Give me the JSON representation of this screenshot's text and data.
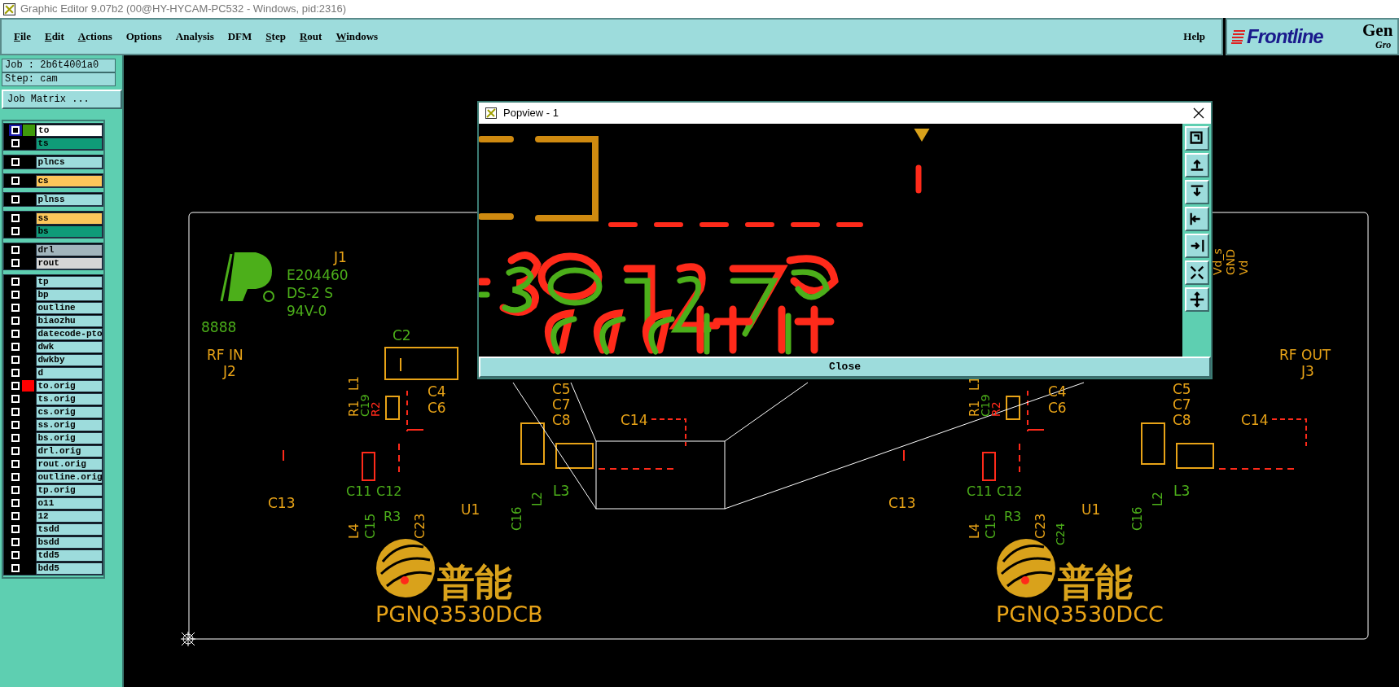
{
  "window": {
    "title": "Graphic Editor 9.07b2 (00@HY-HYCAM-PC532 - Windows, pid:2316)"
  },
  "menu": [
    {
      "label": "File",
      "mnemonic": true
    },
    {
      "label": "Edit",
      "mnemonic": true
    },
    {
      "label": "Actions",
      "mnemonic": true
    },
    {
      "label": "Options",
      "mnemonic": false
    },
    {
      "label": "Analysis",
      "mnemonic": false
    },
    {
      "label": "DFM",
      "mnemonic": false
    },
    {
      "label": "Step",
      "mnemonic": true
    },
    {
      "label": "Rout",
      "mnemonic": true
    },
    {
      "label": "Windows",
      "mnemonic": true
    }
  ],
  "help": "Help",
  "brand": {
    "name": "Frontline",
    "product": "Gen",
    "tagline": "Gro"
  },
  "job": {
    "job": "Job : 2b6t4001a0",
    "step": "Step: cam",
    "matrix_button": "Job Matrix ..."
  },
  "layer_groups": [
    [
      {
        "name": "to",
        "color": "#ffffff",
        "selected": true,
        "swatch": {
          "color": "#3f9a0c"
        }
      },
      {
        "name": "ts",
        "color": "#0f9b78",
        "selected": false
      }
    ],
    [
      {
        "name": "plncs",
        "color": "#9ddcdc",
        "selected": false
      }
    ],
    [
      {
        "name": "cs",
        "color": "#fcc65a",
        "selected": false
      }
    ],
    [
      {
        "name": "plnss",
        "color": "#9ddcdc",
        "selected": false
      }
    ],
    [
      {
        "name": "ss",
        "color": "#fcc65a",
        "selected": false
      },
      {
        "name": "bs",
        "color": "#0f9b78",
        "selected": false
      }
    ],
    [
      {
        "name": "drl",
        "color": "#a2b5bc",
        "selected": false
      },
      {
        "name": "rout",
        "color": "#d6d6d6",
        "selected": false
      }
    ],
    [
      {
        "name": "tp",
        "color": "#9ddcdc",
        "selected": false
      },
      {
        "name": "bp",
        "color": "#9ddcdc",
        "selected": false
      },
      {
        "name": "outline",
        "color": "#9ddcdc",
        "selected": false
      },
      {
        "name": "biaozhu",
        "color": "#9ddcdc",
        "selected": false
      },
      {
        "name": "datecode-pto",
        "color": "#9ddcdc",
        "selected": false
      },
      {
        "name": "dwk",
        "color": "#9ddcdc",
        "selected": false
      },
      {
        "name": "dwkby",
        "color": "#9ddcdc",
        "selected": false
      },
      {
        "name": "d",
        "color": "#9ddcdc",
        "selected": false
      },
      {
        "name": "to.orig",
        "color": "#9ddcdc",
        "selected": false,
        "swatch": {
          "color": "#ff0000"
        }
      },
      {
        "name": "ts.orig",
        "color": "#9ddcdc",
        "selected": false
      },
      {
        "name": "cs.orig",
        "color": "#9ddcdc",
        "selected": false
      },
      {
        "name": "ss.orig",
        "color": "#9ddcdc",
        "selected": false
      },
      {
        "name": "bs.orig",
        "color": "#9ddcdc",
        "selected": false
      },
      {
        "name": "drl.orig",
        "color": "#9ddcdc",
        "selected": false
      },
      {
        "name": "rout.orig",
        "color": "#9ddcdc",
        "selected": false
      },
      {
        "name": "outline.orig",
        "color": "#9ddcdc",
        "selected": false
      },
      {
        "name": "tp.orig",
        "color": "#9ddcdc",
        "selected": false
      },
      {
        "name": "o11",
        "color": "#9ddcdc",
        "selected": false
      },
      {
        "name": "12",
        "color": "#9ddcdc",
        "selected": false
      },
      {
        "name": "tsdd",
        "color": "#9ddcdc",
        "selected": false
      },
      {
        "name": "bsdd",
        "color": "#9ddcdc",
        "selected": false
      },
      {
        "name": "tdd5",
        "color": "#9ddcdc",
        "selected": false
      },
      {
        "name": "bdd5",
        "color": "#9ddcdc",
        "selected": false
      }
    ]
  ],
  "boards": [
    {
      "labels": [
        {
          "text": "J1",
          "color": "#e8a317"
        },
        {
          "text": "E204460",
          "color": "#4caf1a"
        },
        {
          "text": "DS-2 S",
          "color": "#4caf1a"
        },
        {
          "text": "94V-0",
          "color": "#4caf1a"
        },
        {
          "text": "8888",
          "color": "#4caf1a"
        },
        {
          "text": "RF IN",
          "color": "#e8a317"
        },
        {
          "text": "J2",
          "color": "#e8a317"
        },
        {
          "text": "C2",
          "color": "#4caf1a"
        },
        {
          "text": "L1",
          "color": "#e8a317"
        },
        {
          "text": "R1",
          "color": "#e8a317"
        },
        {
          "text": "C19",
          "color": "#4caf1a"
        },
        {
          "text": "R2",
          "color": "#ff2a1a"
        },
        {
          "text": "C4",
          "color": "#e8a317"
        },
        {
          "text": "C6",
          "color": "#e8a317"
        },
        {
          "text": "C5",
          "color": "#e8a317"
        },
        {
          "text": "C7",
          "color": "#e8a317"
        },
        {
          "text": "C8",
          "color": "#e8a317"
        },
        {
          "text": "C14",
          "color": "#e8a317"
        },
        {
          "text": "C13",
          "color": "#e8a317"
        },
        {
          "text": "C11",
          "color": "#4caf1a"
        },
        {
          "text": "C12",
          "color": "#4caf1a"
        },
        {
          "text": "L4",
          "color": "#e8a317"
        },
        {
          "text": "C15",
          "color": "#4caf1a"
        },
        {
          "text": "R3",
          "color": "#4caf1a"
        },
        {
          "text": "C23",
          "color": "#e8a317"
        },
        {
          "text": "U1",
          "color": "#e8a317"
        },
        {
          "text": "C16",
          "color": "#4caf1a"
        },
        {
          "text": "L2",
          "color": "#4caf1a"
        },
        {
          "text": "L3",
          "color": "#4caf1a"
        },
        {
          "text": "普能",
          "color": "#d9a21b"
        },
        {
          "text": "PGNQ3530DCB",
          "color": "#e8a317"
        }
      ]
    },
    {
      "labels": [
        {
          "text": "RF OUT",
          "color": "#e8a317"
        },
        {
          "text": "J3",
          "color": "#e8a317"
        },
        {
          "text": "Vd_s",
          "color": "#e8a317"
        },
        {
          "text": "GND",
          "color": "#e8a317"
        },
        {
          "text": "Vd",
          "color": "#e8a317"
        },
        {
          "text": "L1",
          "color": "#e8a317"
        },
        {
          "text": "R1",
          "color": "#e8a317"
        },
        {
          "text": "C19",
          "color": "#4caf1a"
        },
        {
          "text": "R2",
          "color": "#ff2a1a"
        },
        {
          "text": "C4",
          "color": "#e8a317"
        },
        {
          "text": "C6",
          "color": "#e8a317"
        },
        {
          "text": "C5",
          "color": "#e8a317"
        },
        {
          "text": "C7",
          "color": "#e8a317"
        },
        {
          "text": "C8",
          "color": "#e8a317"
        },
        {
          "text": "C14",
          "color": "#e8a317"
        },
        {
          "text": "C13",
          "color": "#e8a317"
        },
        {
          "text": "C11",
          "color": "#4caf1a"
        },
        {
          "text": "C12",
          "color": "#4caf1a"
        },
        {
          "text": "L4",
          "color": "#e8a317"
        },
        {
          "text": "C15",
          "color": "#4caf1a"
        },
        {
          "text": "R3",
          "color": "#4caf1a"
        },
        {
          "text": "C23",
          "color": "#e8a317"
        },
        {
          "text": "C24",
          "color": "#4caf1a"
        },
        {
          "text": "U1",
          "color": "#e8a317"
        },
        {
          "text": "C16",
          "color": "#4caf1a"
        },
        {
          "text": "L2",
          "color": "#4caf1a"
        },
        {
          "text": "L3",
          "color": "#4caf1a"
        },
        {
          "text": "普能",
          "color": "#d9a21b"
        },
        {
          "text": "PGNQ3530DCC",
          "color": "#e8a317"
        }
      ]
    }
  ],
  "popview": {
    "title": "Popview - 1",
    "close_button": "Close"
  }
}
